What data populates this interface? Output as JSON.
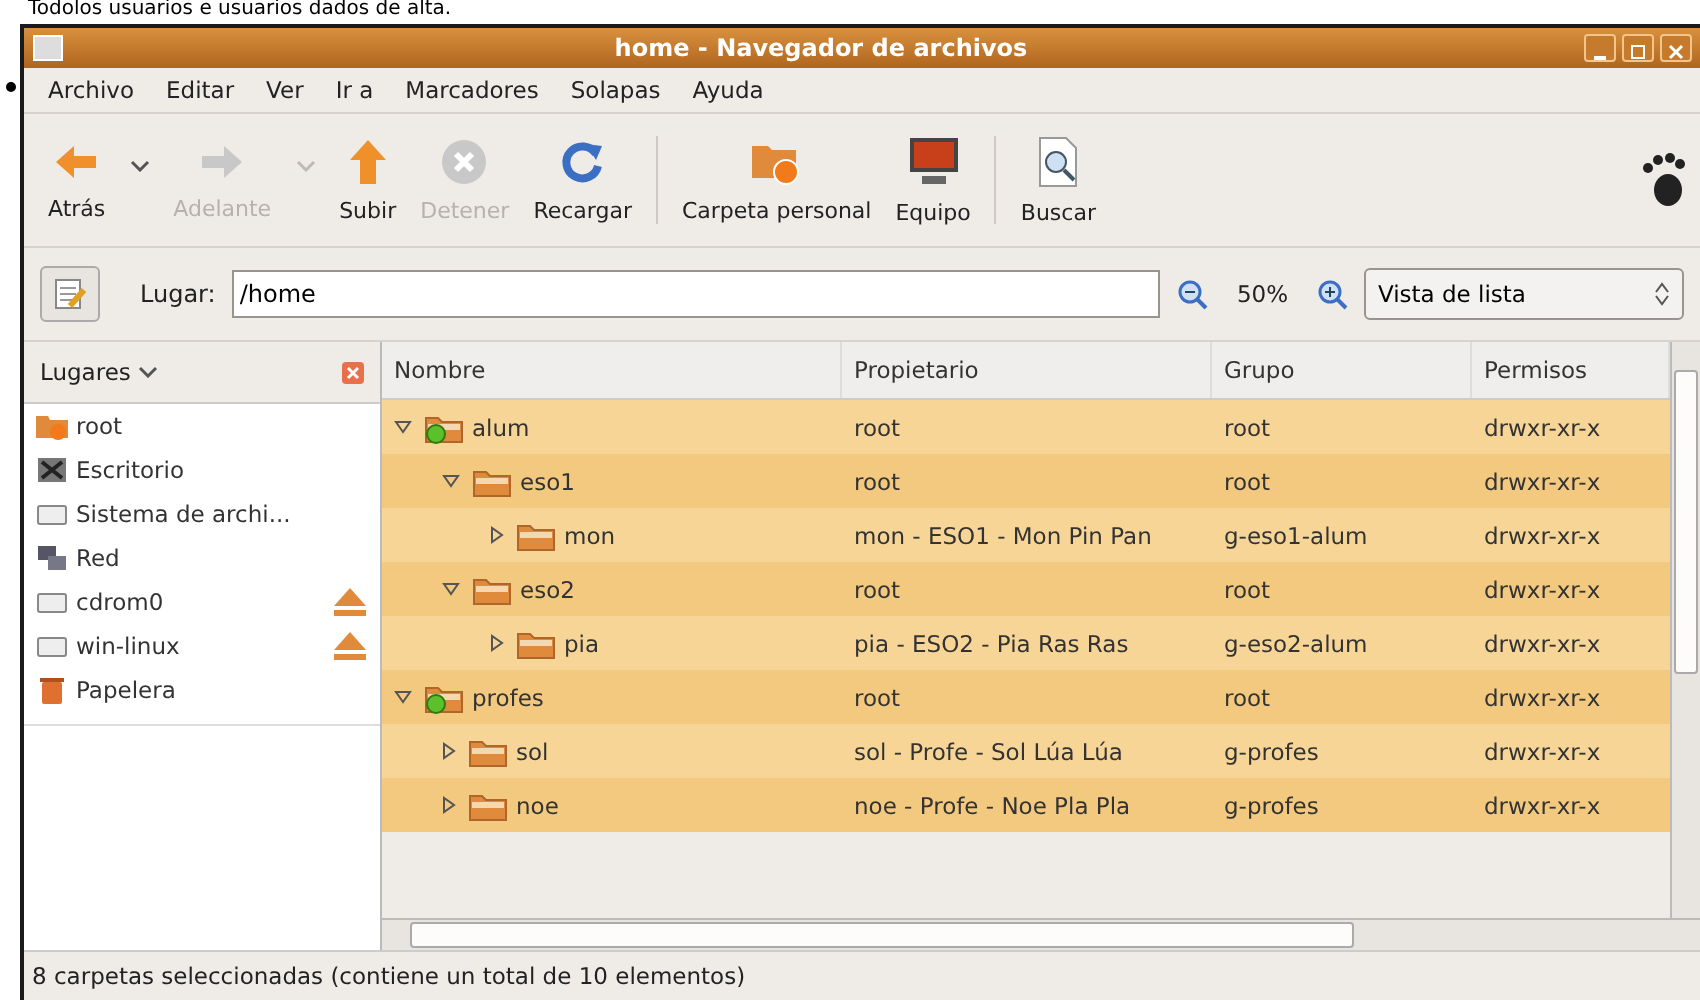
{
  "caption": "Todolos usuarios e usuarios dados de alta.",
  "window": {
    "title": "home - Navegador de archivos"
  },
  "menu": [
    {
      "label": "Archivo"
    },
    {
      "label": "Editar"
    },
    {
      "label": "Ver"
    },
    {
      "label": "Ir a"
    },
    {
      "label": "Marcadores"
    },
    {
      "label": "Solapas"
    },
    {
      "label": "Ayuda"
    }
  ],
  "toolbar": [
    {
      "kind": "back",
      "label": "Atrás",
      "disabled": false,
      "dropdown": true
    },
    {
      "kind": "forward",
      "label": "Adelante",
      "disabled": true,
      "dropdown": true
    },
    {
      "kind": "up",
      "label": "Subir",
      "disabled": false,
      "dropdown": false
    },
    {
      "kind": "stop",
      "label": "Detener",
      "disabled": true,
      "dropdown": false
    },
    {
      "kind": "reload",
      "label": "Recargar",
      "disabled": false,
      "dropdown": false
    },
    {
      "kind": "separator"
    },
    {
      "kind": "home",
      "label": "Carpeta personal",
      "disabled": false,
      "dropdown": false
    },
    {
      "kind": "computer",
      "label": "Equipo",
      "disabled": false,
      "dropdown": false
    },
    {
      "kind": "separator"
    },
    {
      "kind": "search",
      "label": "Buscar",
      "disabled": false,
      "dropdown": false
    }
  ],
  "location": {
    "label": "Lugar:",
    "value": "/home",
    "zoom": "50%",
    "view": "Vista de lista"
  },
  "sidebar": {
    "title": "Lugares",
    "items": [
      {
        "kind": "home",
        "label": "root",
        "eject": false
      },
      {
        "kind": "desktop",
        "label": "Escritorio",
        "eject": false
      },
      {
        "kind": "drive",
        "label": "Sistema de archi...",
        "eject": false
      },
      {
        "kind": "network",
        "label": "Red",
        "eject": false
      },
      {
        "kind": "drive",
        "label": "cdrom0",
        "eject": true
      },
      {
        "kind": "drive",
        "label": "win-linux",
        "eject": true
      },
      {
        "kind": "trash",
        "label": "Papelera",
        "eject": false
      }
    ]
  },
  "table": {
    "columns": [
      "Nombre",
      "Propietario",
      "Grupo",
      "Permisos"
    ],
    "rows": [
      {
        "kind": "shared",
        "name": "alum",
        "owner": "root",
        "group": "root",
        "permissions": "drwxr-xr-x",
        "expanded": true,
        "selected": true,
        "children": [
          {
            "kind": "folder",
            "name": "eso1",
            "owner": "root",
            "group": "root",
            "permissions": "drwxr-xr-x",
            "expanded": true,
            "selected": true,
            "children": [
              {
                "kind": "folder",
                "name": "mon",
                "owner": "mon - ESO1 - Mon Pin Pan",
                "group": "g-eso1-alum",
                "permissions": "drwxr-xr-x",
                "expanded": false,
                "selected": true
              }
            ]
          },
          {
            "kind": "folder",
            "name": "eso2",
            "owner": "root",
            "group": "root",
            "permissions": "drwxr-xr-x",
            "expanded": true,
            "selected": true,
            "children": [
              {
                "kind": "folder",
                "name": "pia",
                "owner": "pia - ESO2 - Pia Ras Ras",
                "group": "g-eso2-alum",
                "permissions": "drwxr-xr-x",
                "expanded": false,
                "selected": true
              }
            ]
          }
        ]
      },
      {
        "kind": "shared",
        "name": "profes",
        "owner": "root",
        "group": "root",
        "permissions": "drwxr-xr-x",
        "expanded": true,
        "selected": true,
        "children": [
          {
            "kind": "folder",
            "name": "sol",
            "owner": "sol - Profe - Sol Lúa Lúa",
            "group": "g-profes",
            "permissions": "drwxr-xr-x",
            "expanded": false,
            "selected": true
          },
          {
            "kind": "folder",
            "name": "noe",
            "owner": "noe - Profe - Noe Pla Pla",
            "group": "g-profes",
            "permissions": "drwxr-xr-x",
            "expanded": false,
            "selected": true
          }
        ]
      }
    ]
  },
  "status_bar": "8 carpetas seleccionadas (contiene un total de 10 elementos)"
}
